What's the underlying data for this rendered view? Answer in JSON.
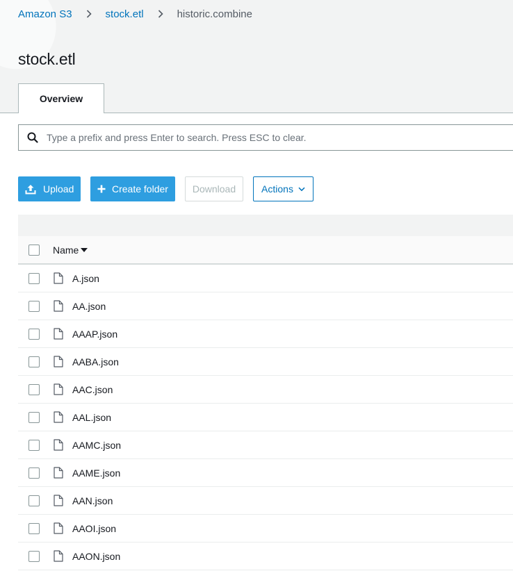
{
  "breadcrumb": {
    "root": "Amazon S3",
    "bucket": "stock.etl",
    "current": "historic.combine"
  },
  "page_title": "stock.etl",
  "tabs": [
    {
      "label": "Overview",
      "active": true
    }
  ],
  "search": {
    "value": "",
    "placeholder": "Type a prefix and press Enter to search. Press ESC to clear."
  },
  "toolbar": {
    "upload_label": "Upload",
    "create_folder_label": "Create folder",
    "download_label": "Download",
    "actions_label": "Actions"
  },
  "table": {
    "column_name": "Name",
    "sort": "descending",
    "rows": [
      "A.json",
      "AA.json",
      "AAAP.json",
      "AABA.json",
      "AAC.json",
      "AAL.json",
      "AAMC.json",
      "AAME.json",
      "AAN.json",
      "AAOI.json",
      "AAON.json"
    ]
  },
  "colors": {
    "link": "#0073bb",
    "primary_button": "#2e9ee0",
    "text": "#16191f",
    "background": "#f2f3f3"
  },
  "icons": {
    "breadcrumb_separator": "chevron-right-icon",
    "search": "search-icon",
    "upload": "upload-icon",
    "create_folder": "plus-icon",
    "actions": "chevron-down-icon",
    "sort": "caret-down-icon",
    "file": "file-icon"
  }
}
